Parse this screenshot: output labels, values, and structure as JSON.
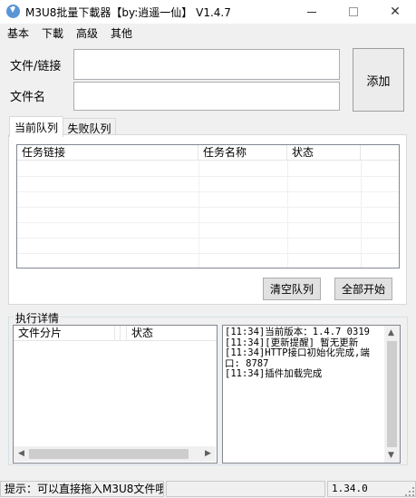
{
  "window": {
    "title": "M3U8批量下載器【by:逍遥一仙】 V1.4.7",
    "minimize_icon": "minimize-icon",
    "maximize_icon": "maximize-icon",
    "close_symbol": "✕"
  },
  "menu": [
    "基本",
    "下載",
    "高级",
    "其他"
  ],
  "form": {
    "file_label": "文件/链接",
    "file_value": "",
    "name_label": "文件名",
    "name_value": "",
    "add_button": "添加"
  },
  "tabs": [
    {
      "label": "当前队列",
      "active": true
    },
    {
      "label": "失败队列",
      "active": false
    }
  ],
  "queue_table": {
    "columns": [
      "任务链接",
      "任务名称",
      "状态"
    ],
    "rows": []
  },
  "queue_buttons": {
    "clear": "清空队列",
    "start_all": "全部开始"
  },
  "details": {
    "group_title": "执行详情",
    "columns": [
      "文件分片",
      "状态"
    ],
    "log_text": "[11:34]当前版本：1.4.7 0319\n[11:34][更新提醒] 暂无更新\n[11:34]HTTP接口初始化完成,端口: 8787\n[11:34]插件加载完成"
  },
  "statusbar": {
    "hint": "提示：可以直接拖入M3U8文件哦",
    "middle": "",
    "version": "1.34.0"
  }
}
